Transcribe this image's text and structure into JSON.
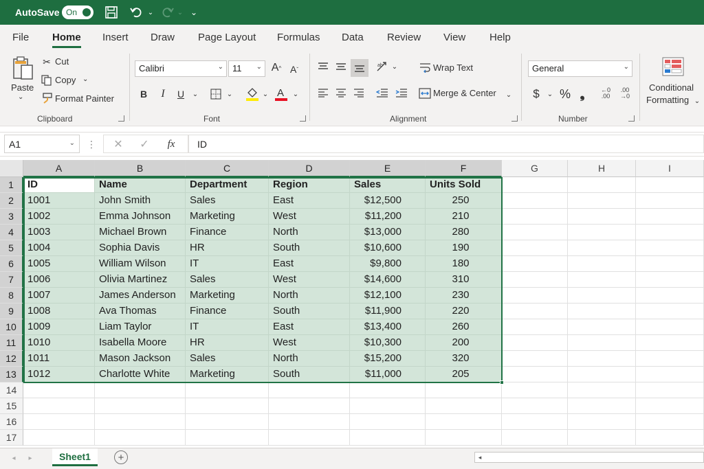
{
  "titlebar": {
    "autosave_label": "AutoSave",
    "toggle_label": "On"
  },
  "tabs": [
    "File",
    "Home",
    "Insert",
    "Draw",
    "Page Layout",
    "Formulas",
    "Data",
    "Review",
    "View",
    "Help"
  ],
  "ribbon": {
    "clipboard": {
      "paste": "Paste",
      "cut": "Cut",
      "copy": "Copy",
      "format_painter": "Format Painter",
      "label": "Clipboard"
    },
    "font": {
      "name": "Calibri",
      "size": "11",
      "label": "Font"
    },
    "alignment": {
      "wrap_text": "Wrap Text",
      "merge_center": "Merge & Center",
      "label": "Alignment"
    },
    "number": {
      "format": "General",
      "label": "Number"
    },
    "styles": {
      "conditional_line1": "Conditional",
      "conditional_line2": "Formatting"
    }
  },
  "formula_bar": {
    "name_box": "A1",
    "fx": "fx",
    "value": "ID"
  },
  "grid": {
    "columns": [
      "A",
      "B",
      "C",
      "D",
      "E",
      "F",
      "G",
      "H",
      "I"
    ],
    "rows": [
      "1",
      "2",
      "3",
      "4",
      "5",
      "6",
      "7",
      "8",
      "9",
      "10",
      "11",
      "12",
      "13",
      "14",
      "15",
      "16",
      "17"
    ],
    "header": [
      "ID",
      "Name",
      "Department",
      "Region",
      "Sales",
      "Units Sold"
    ],
    "data": [
      [
        "1001",
        "John Smith",
        "Sales",
        "East",
        "$12,500",
        "250"
      ],
      [
        "1002",
        "Emma Johnson",
        "Marketing",
        "West",
        "$11,200",
        "210"
      ],
      [
        "1003",
        "Michael Brown",
        "Finance",
        "North",
        "$13,000",
        "280"
      ],
      [
        "1004",
        "Sophia Davis",
        "HR",
        "South",
        "$10,600",
        "190"
      ],
      [
        "1005",
        "William Wilson",
        "IT",
        "East",
        "$9,800",
        "180"
      ],
      [
        "1006",
        "Olivia Martinez",
        "Sales",
        "West",
        "$14,600",
        "310"
      ],
      [
        "1007",
        "James Anderson",
        "Marketing",
        "North",
        "$12,100",
        "230"
      ],
      [
        "1008",
        "Ava Thomas",
        "Finance",
        "South",
        "$11,900",
        "220"
      ],
      [
        "1009",
        "Liam Taylor",
        "IT",
        "East",
        "$13,400",
        "260"
      ],
      [
        "1010",
        "Isabella Moore",
        "HR",
        "West",
        "$10,300",
        "200"
      ],
      [
        "1011",
        "Mason Jackson",
        "Sales",
        "North",
        "$15,200",
        "320"
      ],
      [
        "1012",
        "Charlotte White",
        "Marketing",
        "South",
        "$11,000",
        "205"
      ]
    ]
  },
  "sheets": {
    "active": "Sheet1"
  },
  "colors": {
    "accent": "#1e6e40",
    "selection_fill": "#d3e5d9"
  }
}
